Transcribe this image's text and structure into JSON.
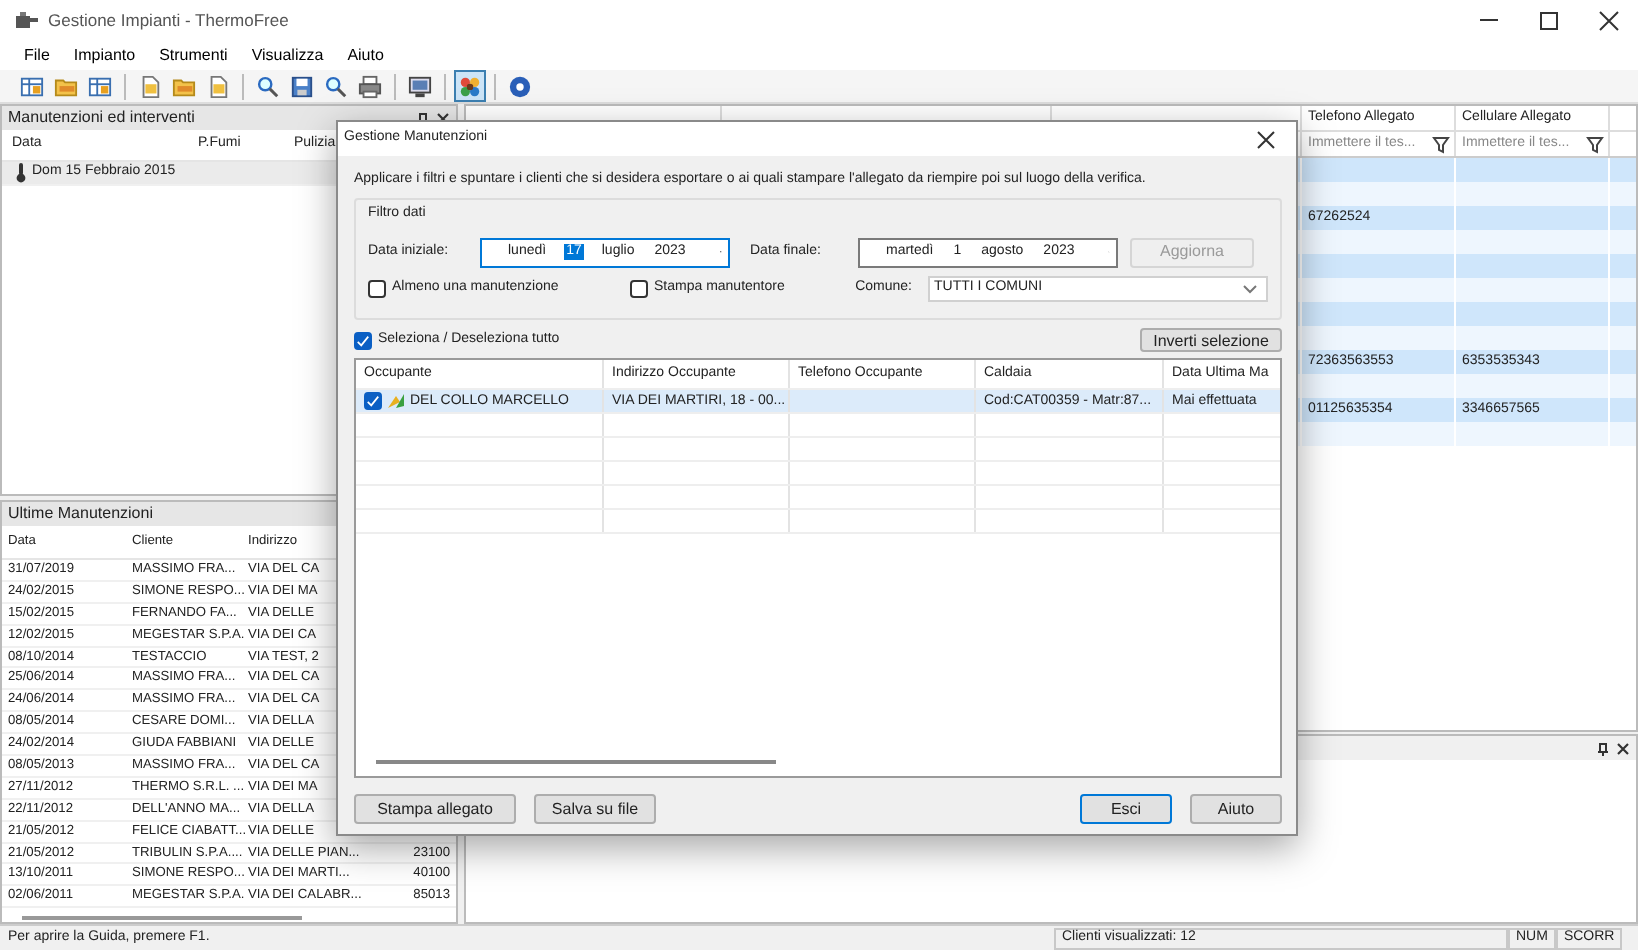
{
  "window": {
    "title": "Gestione Impianti - ThermoFree"
  },
  "menu": [
    "File",
    "Impianto",
    "Strumenti",
    "Visualizza",
    "Aiuto"
  ],
  "toolbar": [
    {
      "kind": "grid",
      "selected": false
    },
    {
      "kind": "folder",
      "selected": false
    },
    {
      "kind": "grid",
      "selected": false
    },
    {
      "kind": "separator"
    },
    {
      "kind": "document",
      "selected": false
    },
    {
      "kind": "folder",
      "selected": false
    },
    {
      "kind": "document",
      "selected": false
    },
    {
      "kind": "separator"
    },
    {
      "kind": "search",
      "selected": false
    },
    {
      "kind": "disk",
      "selected": false
    },
    {
      "kind": "search",
      "selected": false
    },
    {
      "kind": "printer",
      "selected": false
    },
    {
      "kind": "separator"
    },
    {
      "kind": "monitor",
      "selected": false
    },
    {
      "kind": "separator"
    },
    {
      "kind": "flower",
      "selected": true
    },
    {
      "kind": "separator"
    },
    {
      "kind": "help",
      "selected": false
    }
  ],
  "interventions_panel": {
    "title": "Manutenzioni ed interventi",
    "columns": [
      "Data",
      "P.Fumi",
      "Pulizia"
    ],
    "rows": [
      {
        "date": "Dom 15 Febbraio 2015"
      }
    ]
  },
  "last_maintenance": {
    "title": "Ultime Manutenzioni",
    "columns": [
      "Data",
      "Cliente",
      "Indirizzo"
    ],
    "rows": [
      {
        "date": "31/07/2019",
        "client": "MASSIMO FRA...",
        "address": "VIA DEL CA"
      },
      {
        "date": "24/02/2015",
        "client": "SIMONE RESPO...",
        "address": "VIA DEI MA"
      },
      {
        "date": "15/02/2015",
        "client": "FERNANDO FA...",
        "address": "VIA DELLE"
      },
      {
        "date": "12/02/2015",
        "client": "MEGESTAR S.P.A.",
        "address": "VIA DEI CA"
      },
      {
        "date": "08/10/2014",
        "client": "TESTACCIO",
        "address": "VIA TEST, 2"
      },
      {
        "date": "25/06/2014",
        "client": "MASSIMO FRA...",
        "address": "VIA DEL CA"
      },
      {
        "date": "24/06/2014",
        "client": "MASSIMO FRA...",
        "address": "VIA DEL CA"
      },
      {
        "date": "08/05/2014",
        "client": "CESARE DOMI...",
        "address": "VIA DELLA"
      },
      {
        "date": "24/02/2014",
        "client": "GIUDA FABBIANI",
        "address": "VIA DELLE"
      },
      {
        "date": "08/05/2013",
        "client": "MASSIMO FRA...",
        "address": "VIA DEL CA"
      },
      {
        "date": "27/11/2012",
        "client": "THERMO S.R.L. ...",
        "address": "VIA DEI MA"
      },
      {
        "date": "22/11/2012",
        "client": "DELL'ANNO MA...",
        "address": "VIA DELLA"
      },
      {
        "date": "21/05/2012",
        "client": "FELICE CIABATT...",
        "address": "VIA DELLE"
      },
      {
        "date": "21/05/2012",
        "client": "TRIBULIN S.P.A....",
        "address": "VIA DELLE PIAN...",
        "column_4": "23100"
      },
      {
        "date": "13/10/2011",
        "client": "SIMONE RESPO...",
        "address": "VIA DEI MARTI...",
        "column_4": "40100"
      },
      {
        "date": "02/06/2011",
        "client": "MEGESTAR S.P.A.",
        "address": "VIA DEI CALABR...",
        "column_4": "85013"
      }
    ]
  },
  "attachments_grid": {
    "columns": [
      {
        "label": "Telefono Allegato",
        "placeholder": "Immettere il tes..."
      },
      {
        "label": "Cellulare Allegato",
        "placeholder": "Immettere il tes..."
      }
    ],
    "rows": [
      {},
      {},
      {
        "telefono": "67262524"
      },
      {},
      {},
      {},
      {},
      {},
      {
        "telefono": "72363563553",
        "cellulare": "6353535343"
      },
      {},
      {
        "telefono": "01125635354",
        "cellulare": "3346657565"
      },
      {}
    ]
  },
  "dialog": {
    "title": "Gestione Manutenzioni",
    "instructions": "Applicare i filtri e spuntare i clienti che si desidera esportare o ai quali stampare l'allegato da riempire  poi sul luogo della verifica.",
    "filter": {
      "title": "Filtro dati",
      "start_label": "Data iniziale:",
      "start_date": {
        "weekday": "lunedì",
        "day": "17",
        "month": "luglio",
        "year": "2023",
        "day_selected": true
      },
      "end_label": "Data finale:",
      "end_date": {
        "weekday": "martedì",
        "day": "1",
        "month": "agosto",
        "year": "2023",
        "day_selected": false
      },
      "refresh_button": {
        "label": "Aggiorna",
        "disabled": true
      },
      "checkboxes": [
        {
          "label": "Almeno una manutenzione",
          "checked": false
        },
        {
          "label": "Stampa manutentore",
          "checked": false
        }
      ],
      "comune_label": "Comune:",
      "comune_value": "TUTTI I COMUNI"
    },
    "select_all": {
      "label": "Seleziona / Deseleziona tutto",
      "checked": true
    },
    "invert_button": "Inverti selezione",
    "columns": [
      "Occupante",
      "Indirizzo Occupante",
      "Telefono Occupante",
      "Caldaia",
      "Data Ultima Ma"
    ],
    "rows": [
      {
        "checked": true,
        "selected": true,
        "cells": [
          "DEL COLLO MARCELLO",
          "VIA DEI MARTIRI, 18 - 00...",
          "",
          "Cod:CAT00359 - Matr:87...",
          "Mai effettuata"
        ]
      }
    ],
    "buttons": [
      {
        "label": "Stampa allegato",
        "default": false
      },
      {
        "label": "Salva su file",
        "default": false
      },
      {
        "label": "Esci",
        "default": true
      },
      {
        "label": "Aiuto",
        "default": false
      }
    ]
  },
  "status_bar": [
    "Per aprire la Guida, premere F1.",
    "Clienti visualizzati: 12",
    "NUM",
    "SCORR"
  ]
}
